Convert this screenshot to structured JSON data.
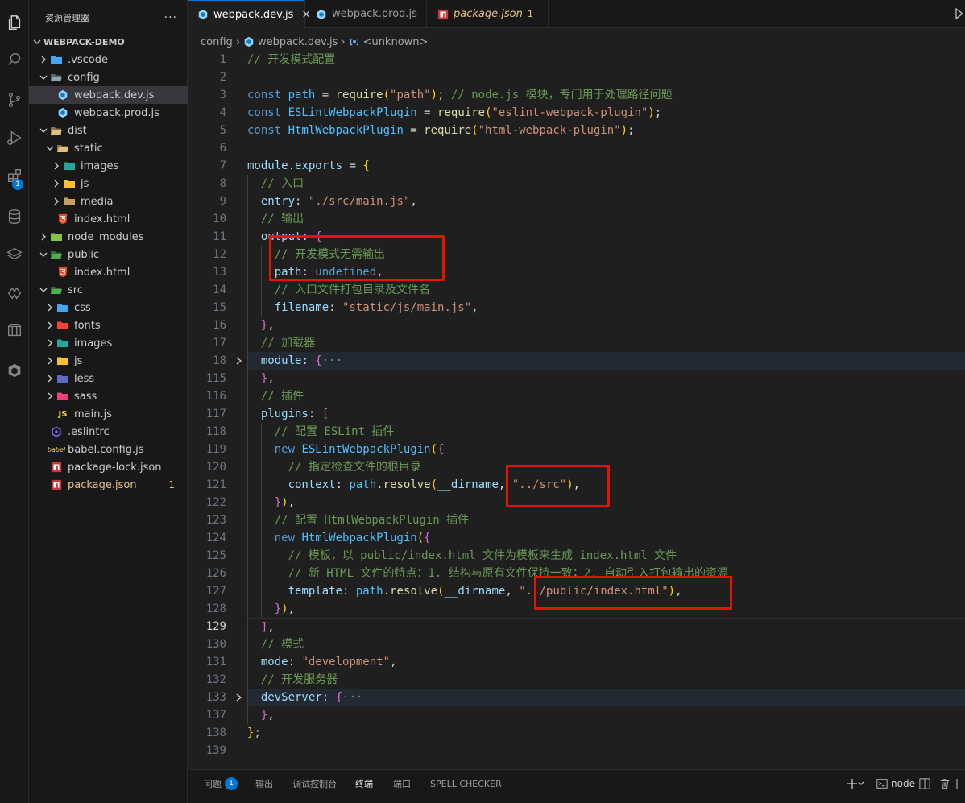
{
  "activity_bar": {
    "items": [
      {
        "name": "explorer",
        "icon": "files-icon"
      },
      {
        "name": "search",
        "icon": "search-icon"
      },
      {
        "name": "source-control",
        "icon": "source-control-icon"
      },
      {
        "name": "run-debug",
        "icon": "run-debug-icon"
      },
      {
        "name": "extensions",
        "icon": "extensions-icon",
        "badge": "1"
      },
      {
        "name": "database",
        "icon": "database-icon"
      },
      {
        "name": "layers",
        "icon": "layers-icon"
      },
      {
        "name": "remote",
        "icon": "remote-icon"
      },
      {
        "name": "packages",
        "icon": "package-icon"
      },
      {
        "name": "docker",
        "icon": "cube-icon"
      }
    ]
  },
  "sidebar": {
    "title": "资源管理器",
    "more": "···",
    "tree": [
      {
        "label": "WEBPACK-DEMO",
        "kind": "root",
        "open": true,
        "depth": 0
      },
      {
        "label": ".vscode",
        "kind": "folder",
        "icon_color": "#42a5f5",
        "open": false,
        "depth": 1
      },
      {
        "label": "config",
        "kind": "folder",
        "icon_color": "#90a4ae",
        "open": true,
        "depth": 1
      },
      {
        "label": "webpack.dev.js",
        "kind": "webpack",
        "depth": 2,
        "selected": true
      },
      {
        "label": "webpack.prod.js",
        "kind": "webpack",
        "depth": 2
      },
      {
        "label": "dist",
        "kind": "folder",
        "icon_color": "#e5c07b",
        "open": true,
        "depth": 1
      },
      {
        "label": "static",
        "kind": "folder",
        "icon_color": "#e5c07b",
        "open": true,
        "depth": 2
      },
      {
        "label": "images",
        "kind": "folder",
        "icon_color": "#26a69a",
        "open": false,
        "depth": 3
      },
      {
        "label": "js",
        "kind": "folder",
        "icon_color": "#fbc02d",
        "open": false,
        "depth": 3
      },
      {
        "label": "media",
        "kind": "folder",
        "icon_color": "#c89f5d",
        "open": false,
        "depth": 3
      },
      {
        "label": "index.html",
        "kind": "html",
        "depth": 2
      },
      {
        "label": "node_modules",
        "kind": "folder",
        "icon_color": "#8bc34a",
        "open": false,
        "depth": 1
      },
      {
        "label": "public",
        "kind": "folder",
        "icon_color": "#4caf50",
        "open": true,
        "depth": 1
      },
      {
        "label": "index.html",
        "kind": "html",
        "depth": 2
      },
      {
        "label": "src",
        "kind": "folder",
        "icon_color": "#4caf50",
        "open": true,
        "depth": 1
      },
      {
        "label": "css",
        "kind": "folder",
        "icon_color": "#42a5f5",
        "open": false,
        "depth": 2
      },
      {
        "label": "fonts",
        "kind": "folder",
        "icon_color": "#f44336",
        "open": false,
        "depth": 2
      },
      {
        "label": "images",
        "kind": "folder",
        "icon_color": "#26a69a",
        "open": false,
        "depth": 2
      },
      {
        "label": "js",
        "kind": "folder",
        "icon_color": "#fbc02d",
        "open": false,
        "depth": 2
      },
      {
        "label": "less",
        "kind": "folder",
        "icon_color": "#5c6bc0",
        "open": false,
        "depth": 2
      },
      {
        "label": "sass",
        "kind": "folder",
        "icon_color": "#ec407a",
        "open": false,
        "depth": 2
      },
      {
        "label": "main.js",
        "kind": "js",
        "depth": 2,
        "badge_text": "JS"
      },
      {
        "label": ".eslintrc",
        "kind": "eslint",
        "depth": 1
      },
      {
        "label": "babel.config.js",
        "kind": "babel",
        "depth": 1,
        "badge_text": "babel"
      },
      {
        "label": "package-lock.json",
        "kind": "npm",
        "depth": 1
      },
      {
        "label": "package.json",
        "kind": "npm",
        "depth": 1,
        "warn": true,
        "count": "1"
      }
    ]
  },
  "tabs": [
    {
      "label": "webpack.dev.js",
      "icon": "webpack-icon",
      "active": true,
      "close": "×"
    },
    {
      "label": "webpack.prod.js",
      "icon": "webpack-icon",
      "active": false
    },
    {
      "label": "package.json",
      "icon": "npm-icon",
      "active": false,
      "warn": true,
      "count": "1"
    }
  ],
  "breadcrumb": {
    "parts": [
      "config",
      "webpack.dev.js",
      "<unknown>"
    ],
    "sep": "›"
  },
  "editor": {
    "current_line": "129",
    "highlight_lines": [
      "18",
      "133"
    ],
    "lines": [
      {
        "n": "1",
        "indent": 0,
        "t": [
          [
            "cm",
            "// 开发模式配置"
          ]
        ]
      },
      {
        "n": "2",
        "indent": 0,
        "t": []
      },
      {
        "n": "3",
        "indent": 0,
        "t": [
          [
            "kw",
            "const "
          ],
          [
            "cn",
            "path"
          ],
          [
            "pu",
            " = "
          ],
          [
            "fn",
            "require"
          ],
          [
            "p",
            "("
          ],
          [
            "s",
            "\"path\""
          ],
          [
            "p",
            ")"
          ],
          [
            "pu",
            "; "
          ],
          [
            "cm",
            "// node.js 模块，专门用于处理路径问题"
          ]
        ]
      },
      {
        "n": "4",
        "indent": 0,
        "t": [
          [
            "kw",
            "const "
          ],
          [
            "cn",
            "ESLintWebpackPlugin"
          ],
          [
            "pu",
            " = "
          ],
          [
            "fn",
            "require"
          ],
          [
            "p",
            "("
          ],
          [
            "s",
            "\"eslint-webpack-plugin\""
          ],
          [
            "p",
            ")"
          ],
          [
            "pu",
            ";"
          ]
        ]
      },
      {
        "n": "5",
        "indent": 0,
        "t": [
          [
            "kw",
            "const "
          ],
          [
            "cn",
            "HtmlWebpackPlugin"
          ],
          [
            "pu",
            " = "
          ],
          [
            "fn",
            "require"
          ],
          [
            "p",
            "("
          ],
          [
            "s",
            "\"html-webpack-plugin\""
          ],
          [
            "p",
            ")"
          ],
          [
            "pu",
            ";"
          ]
        ]
      },
      {
        "n": "6",
        "indent": 0,
        "t": []
      },
      {
        "n": "7",
        "indent": 0,
        "t": [
          [
            "v",
            "module"
          ],
          [
            "pu",
            "."
          ],
          [
            "v",
            "exports"
          ],
          [
            "pu",
            " = "
          ],
          [
            "p",
            "{"
          ]
        ]
      },
      {
        "n": "8",
        "indent": 1,
        "t": [
          [
            "cm",
            "// 入口"
          ]
        ]
      },
      {
        "n": "9",
        "indent": 1,
        "t": [
          [
            "v",
            "entry"
          ],
          [
            "pu",
            ": "
          ],
          [
            "s",
            "\"./src/main.js\""
          ],
          [
            "pu",
            ","
          ]
        ]
      },
      {
        "n": "10",
        "indent": 1,
        "t": [
          [
            "cm",
            "// 输出"
          ]
        ]
      },
      {
        "n": "11",
        "indent": 1,
        "t": [
          [
            "v",
            "output"
          ],
          [
            "pu",
            ": "
          ],
          [
            "pp",
            "{"
          ]
        ]
      },
      {
        "n": "12",
        "indent": 2,
        "t": [
          [
            "cm",
            "// 开发模式无需输出"
          ]
        ]
      },
      {
        "n": "13",
        "indent": 2,
        "t": [
          [
            "v",
            "path"
          ],
          [
            "pu",
            ": "
          ],
          [
            "kw",
            "undefined"
          ],
          [
            "pu",
            ","
          ]
        ]
      },
      {
        "n": "14",
        "indent": 2,
        "t": [
          [
            "cm",
            "// 入口文件打包目录及文件名"
          ]
        ]
      },
      {
        "n": "15",
        "indent": 2,
        "t": [
          [
            "v",
            "filename"
          ],
          [
            "pu",
            ": "
          ],
          [
            "s",
            "\"static/js/main.js\""
          ],
          [
            "pu",
            ","
          ]
        ]
      },
      {
        "n": "16",
        "indent": 1,
        "t": [
          [
            "pp",
            "}"
          ],
          [
            "pu",
            ","
          ]
        ]
      },
      {
        "n": "17",
        "indent": 1,
        "t": [
          [
            "cm",
            "// 加载器"
          ]
        ]
      },
      {
        "n": "18",
        "indent": 1,
        "fold": true,
        "t": [
          [
            "v",
            "module"
          ],
          [
            "pu",
            ": "
          ],
          [
            "pp",
            "{"
          ],
          [
            "fl",
            "···"
          ]
        ]
      },
      {
        "n": "115",
        "indent": 1,
        "t": [
          [
            "pp",
            "}"
          ],
          [
            "pu",
            ","
          ]
        ]
      },
      {
        "n": "116",
        "indent": 1,
        "t": [
          [
            "cm",
            "// 插件"
          ]
        ]
      },
      {
        "n": "117",
        "indent": 1,
        "t": [
          [
            "v",
            "plugins"
          ],
          [
            "pu",
            ": "
          ],
          [
            "pp",
            "["
          ]
        ]
      },
      {
        "n": "118",
        "indent": 2,
        "t": [
          [
            "cm",
            "// 配置 ESLint 插件"
          ]
        ]
      },
      {
        "n": "119",
        "indent": 2,
        "t": [
          [
            "kw",
            "new "
          ],
          [
            "cn",
            "ESLintWebpackPlugin"
          ],
          [
            "p",
            "("
          ],
          [
            "pp",
            "{"
          ]
        ]
      },
      {
        "n": "120",
        "indent": 3,
        "t": [
          [
            "cm",
            "// 指定检查文件的根目录"
          ]
        ]
      },
      {
        "n": "121",
        "indent": 3,
        "t": [
          [
            "v",
            "context"
          ],
          [
            "pu",
            ": "
          ],
          [
            "cn",
            "path"
          ],
          [
            "pu",
            "."
          ],
          [
            "fn",
            "resolve"
          ],
          [
            "p",
            "("
          ],
          [
            "v",
            "__dirname"
          ],
          [
            "pu",
            ", "
          ],
          [
            "s",
            "\"../src\""
          ],
          [
            "p",
            ")"
          ],
          [
            "pu",
            ","
          ]
        ]
      },
      {
        "n": "122",
        "indent": 2,
        "t": [
          [
            "pp",
            "}"
          ],
          [
            "p",
            ")"
          ],
          [
            "pu",
            ","
          ]
        ]
      },
      {
        "n": "123",
        "indent": 2,
        "t": [
          [
            "cm",
            "// 配置 HtmlWebpackPlugin 插件"
          ]
        ]
      },
      {
        "n": "124",
        "indent": 2,
        "t": [
          [
            "kw",
            "new "
          ],
          [
            "cn",
            "HtmlWebpackPlugin"
          ],
          [
            "p",
            "("
          ],
          [
            "pp",
            "{"
          ]
        ]
      },
      {
        "n": "125",
        "indent": 3,
        "t": [
          [
            "cm",
            "// 模板，以 public/index.html 文件为模板来生成 index.html 文件"
          ]
        ]
      },
      {
        "n": "126",
        "indent": 3,
        "t": [
          [
            "cm",
            "// 新 HTML 文件的特点：1. 结构与原有文件保持一致；2. 自动引入打包输出的资源"
          ]
        ]
      },
      {
        "n": "127",
        "indent": 3,
        "t": [
          [
            "v",
            "template"
          ],
          [
            "pu",
            ": "
          ],
          [
            "cn",
            "path"
          ],
          [
            "pu",
            "."
          ],
          [
            "fn",
            "resolve"
          ],
          [
            "p",
            "("
          ],
          [
            "v",
            "__dirname"
          ],
          [
            "pu",
            ", "
          ],
          [
            "s",
            "\"../public/index.html\""
          ],
          [
            "p",
            ")"
          ],
          [
            "pu",
            ","
          ]
        ]
      },
      {
        "n": "128",
        "indent": 2,
        "t": [
          [
            "pp",
            "}"
          ],
          [
            "p",
            ")"
          ],
          [
            "pu",
            ","
          ]
        ]
      },
      {
        "n": "129",
        "indent": 1,
        "t": [
          [
            "pp",
            "]"
          ],
          [
            "pu",
            ","
          ]
        ]
      },
      {
        "n": "130",
        "indent": 1,
        "t": [
          [
            "cm",
            "// 模式"
          ]
        ]
      },
      {
        "n": "131",
        "indent": 1,
        "t": [
          [
            "v",
            "mode"
          ],
          [
            "pu",
            ": "
          ],
          [
            "s",
            "\"development\""
          ],
          [
            "pu",
            ","
          ]
        ]
      },
      {
        "n": "132",
        "indent": 1,
        "t": [
          [
            "cm",
            "// 开发服务器"
          ]
        ]
      },
      {
        "n": "133",
        "indent": 1,
        "fold": true,
        "t": [
          [
            "v",
            "devServer"
          ],
          [
            "pu",
            ": "
          ],
          [
            "pp",
            "{"
          ],
          [
            "fl",
            "···"
          ]
        ]
      },
      {
        "n": "137",
        "indent": 1,
        "t": [
          [
            "pp",
            "}"
          ],
          [
            "pu",
            ","
          ]
        ]
      },
      {
        "n": "138",
        "indent": 0,
        "t": [
          [
            "p",
            "}"
          ],
          [
            "pu",
            ";"
          ]
        ]
      },
      {
        "n": "139",
        "indent": 0,
        "t": []
      }
    ]
  },
  "panel": {
    "tabs": [
      {
        "label": "问题",
        "badge": "1"
      },
      {
        "label": "输出"
      },
      {
        "label": "调试控制台"
      },
      {
        "label": "终端",
        "active": true
      },
      {
        "label": "端口"
      },
      {
        "label": "SPELL CHECKER"
      }
    ],
    "terminal_name": "node"
  }
}
